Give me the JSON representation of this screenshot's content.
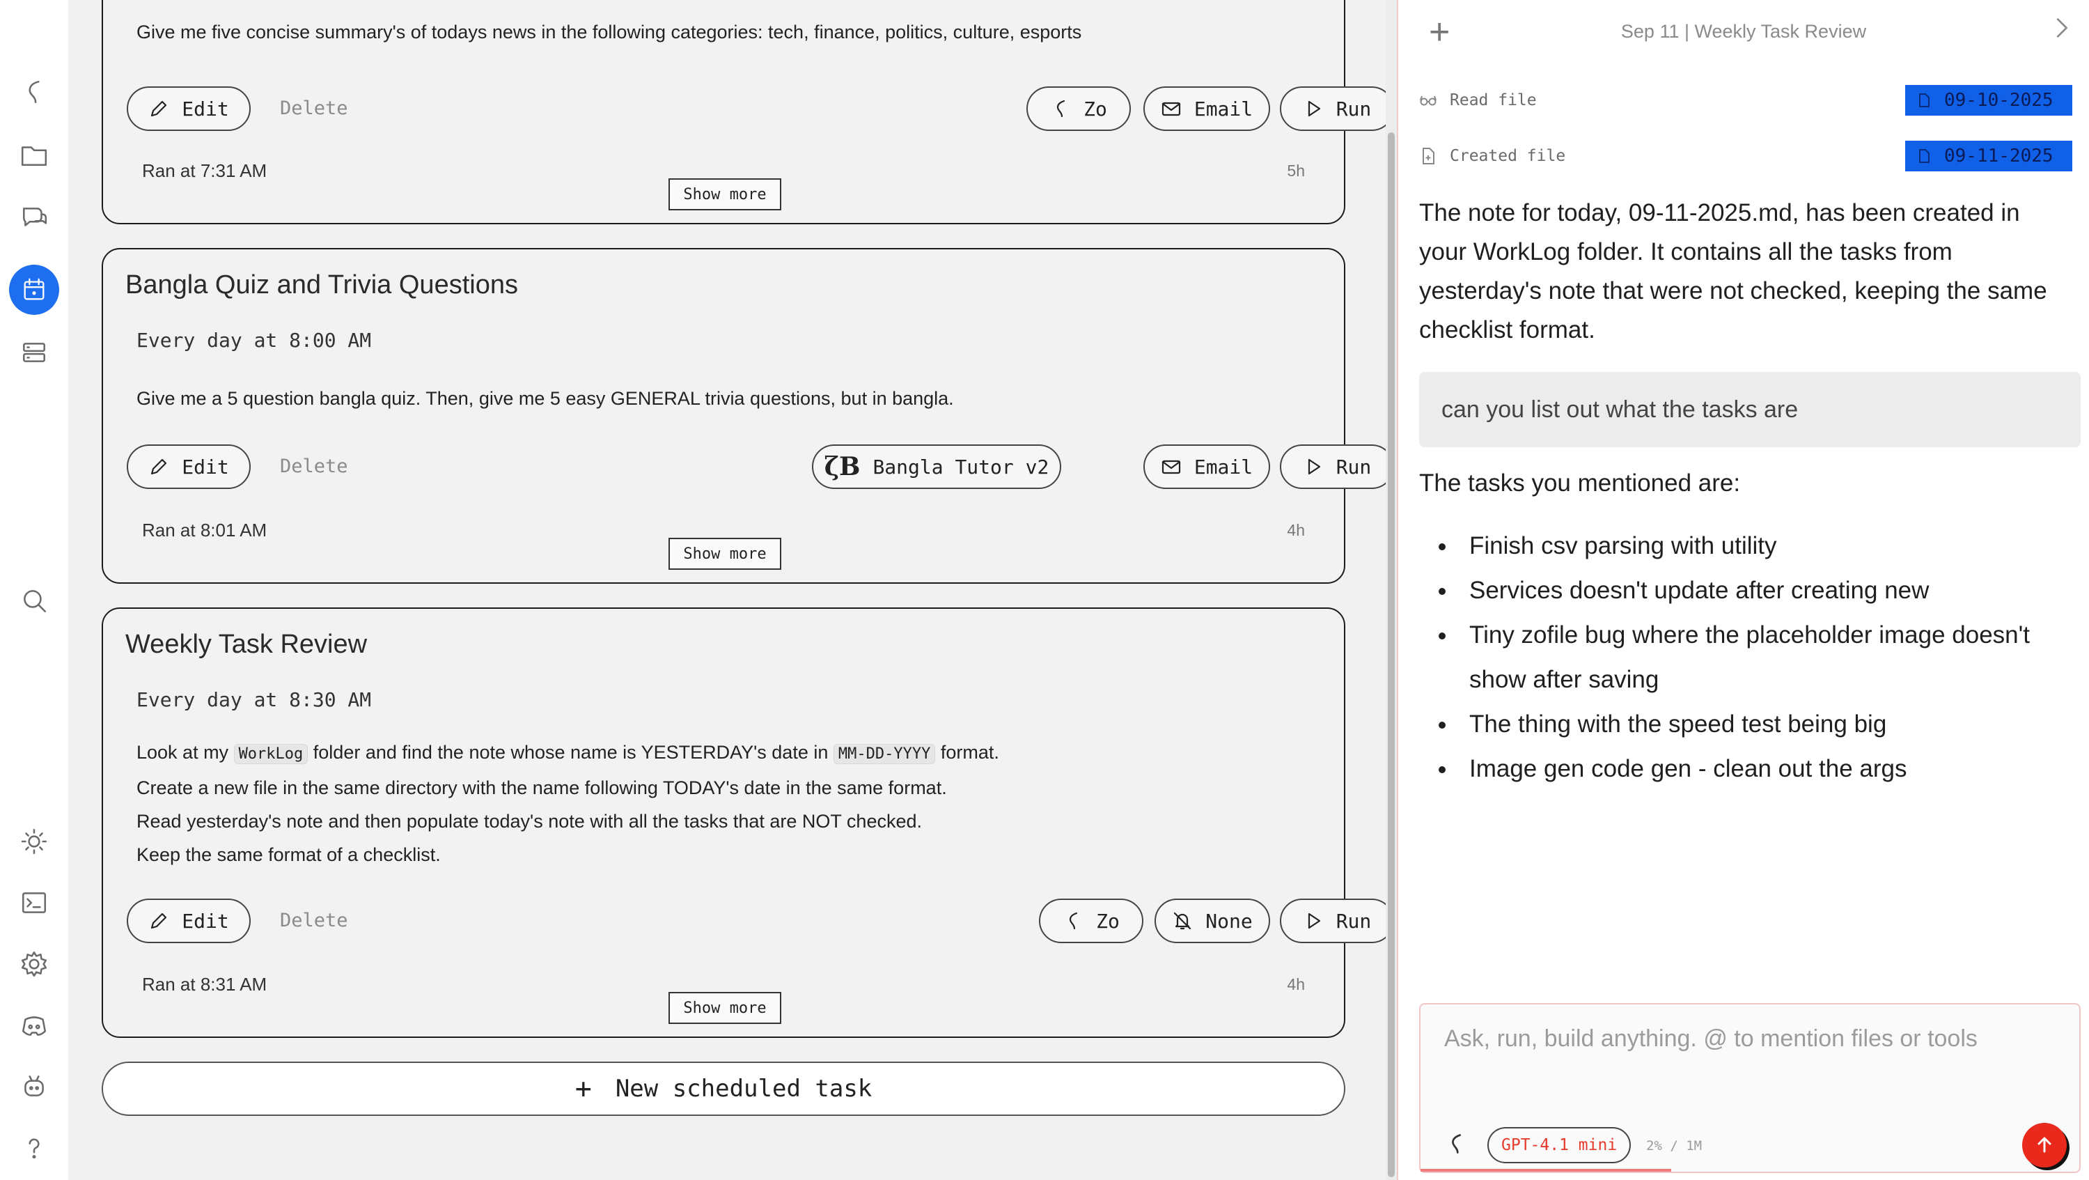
{
  "sidebar": {
    "icons": [
      "zo-logo-icon",
      "folder-icon",
      "chat-icon",
      "calendar-icon",
      "storage-icon",
      "search-icon",
      "sun-icon",
      "terminal-icon",
      "settings-icon",
      "discord-icon",
      "bot-icon",
      "help-icon"
    ],
    "active": "calendar-icon"
  },
  "cards": [
    {
      "prompt": "Give me five concise summary's of todays news in the following categories: tech, finance, politics, culture, esports",
      "edit_label": "Edit",
      "delete_label": "Delete",
      "persona_label": "Zo",
      "delivery_label": "Email",
      "run_label": "Run",
      "ran_at": "Ran at 7:31 AM",
      "age": "5h",
      "show_more": "Show more"
    },
    {
      "title": "Bangla Quiz and Trivia Questions",
      "schedule": "Every day at 8:00 AM",
      "prompt": "Give me a 5 question bangla quiz. Then, give me 5 easy GENERAL trivia questions, but in bangla.",
      "edit_label": "Edit",
      "delete_label": "Delete",
      "persona_label": "Bangla Tutor v2",
      "delivery_label": "Email",
      "run_label": "Run",
      "ran_at": "Ran at 8:01 AM",
      "age": "4h",
      "show_more": "Show more"
    },
    {
      "title": "Weekly Task Review",
      "schedule": "Every day at 8:30 AM",
      "prompt_parts": {
        "l1a": "Look at my ",
        "l1code1": "WorkLog",
        "l1b": " folder and find the note whose name is YESTERDAY's date in ",
        "l1code2": "MM-DD-YYYY",
        "l1c": " format.",
        "l2": "Create a new file in the same directory with the name following TODAY's date in the same format.",
        "l3": "Read yesterday's note and then populate today's note with all the tasks that are NOT checked.",
        "l4": "Keep the same format of a checklist."
      },
      "edit_label": "Edit",
      "delete_label": "Delete",
      "persona_label": "Zo",
      "delivery_label": "None",
      "run_label": "Run",
      "ran_at": "Ran at 8:31 AM",
      "age": "4h",
      "show_more": "Show more"
    }
  ],
  "new_task_label": "New scheduled task",
  "chat": {
    "header_title": "Sep 11 | Weekly Task Review",
    "tool_calls": [
      {
        "label": "Read file",
        "file": "09-10-2025"
      },
      {
        "label": "Created file",
        "file": "09-11-2025"
      }
    ],
    "answer": "The note for today, 09-11-2025.md, has been created in your WorkLog folder. It contains all the tasks from yesterday's note that were not checked, keeping the same checklist format.",
    "user_message": "can you list out what the tasks are",
    "reply_intro": "The tasks you mentioned are:",
    "tasks": [
      "Finish csv parsing with utility",
      "Services doesn't update after creating new",
      "Tiny zofile bug where the placeholder image doesn't show after saving",
      "The thing with the speed test being big",
      "Image gen code gen - clean out the args"
    ],
    "composer_placeholder": "Ask, run, build anything. @ to mention files or tools",
    "model": "GPT-4.1 mini",
    "usage": "2% / 1M",
    "accent": "#1e6ff0",
    "send_color": "#e8291c"
  }
}
